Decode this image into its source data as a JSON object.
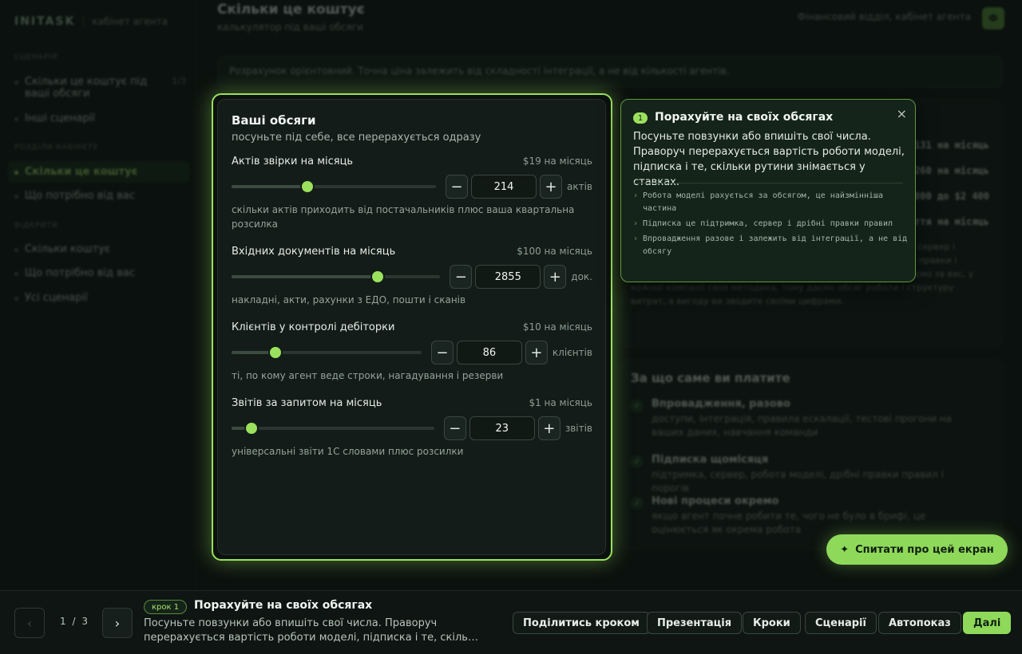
{
  "sidebar": {
    "brand": "INITASK",
    "brand_sub": "кабінет агента",
    "section_scenario": "СЦЕНАРІЙ",
    "scenario_items": [
      {
        "label": "Скільки це коштує під ваші обсяги",
        "count": "1/3"
      },
      {
        "label": "Інші сценарії"
      }
    ],
    "section_page": "РОЗДІЛИ КАБІНЕТУ",
    "page_items": [
      {
        "label": "Скільки це коштує"
      },
      {
        "label": "Що потрібно від вас"
      }
    ],
    "section_jump": "ВІДКРИТИ",
    "jump_items": [
      {
        "label": "Скільки коштує"
      },
      {
        "label": "Що потрібно від вас"
      },
      {
        "label": "Усі сценарії"
      }
    ]
  },
  "header": {
    "title": "Скільки це коштує",
    "subtitle": "калькулятор під ваші обсяги",
    "account": "Фінансовий відділ, кабінет агента",
    "avatar": "Ф"
  },
  "notice": "Розрахунок орієнтовний. Точна ціна залежить від складності інтеграції, а не від кількості агентів.",
  "calculator": {
    "title": "Ваші обсяги",
    "subtitle": "посуньте під себе, все перерахується одразу",
    "fields": [
      {
        "label": "Актів звірки на місяць",
        "price": "$19 на місяць",
        "value": "214",
        "unit": "актів",
        "help": "скільки актів приходить від постачальників плюс ваша квартальна розсилка",
        "fraction": 0.37
      },
      {
        "label": "Вхідних документів на місяць",
        "price": "$100 на місяць",
        "value": "2855",
        "unit": "док.",
        "help": "накладні, акти, рахунки з ЕДО, пошти і сканів",
        "fraction": 0.7
      },
      {
        "label": "Клієнтів у контролі дебіторки",
        "price": "$10 на місяць",
        "value": "86",
        "unit": "клієнтів",
        "help": "ті, по кому агент веде строки, нагадування і резерви",
        "fraction": 0.23
      },
      {
        "label": "Звітів за запитом на місяць",
        "price": "$1 на місяць",
        "value": "23",
        "unit": "звітів",
        "help": "універсальні звіти 1С словами плюс розсилки",
        "fraction": 0.1
      }
    ],
    "minus": "−",
    "plus": "+"
  },
  "costs": {
    "rows": [
      {
        "value": "$131 на місяць"
      },
      {
        "value": "$260 на місяць"
      },
      {
        "value": "$800 до $2 400"
      },
      {
        "value": "$ття на місяць"
      }
    ],
    "paragraph": "Робота моделі рахується за обсягом. Підписка це підтримка, сервер і дрібні правки правил і порогів. Впровадження разове. Дрібні правки і порогів тримаються в межах підписки. Окупність ми не рахуємо за вас, у кожної компанії своя методика, тому даємо обсяг роботи і структуру витрат, а вигоду ви зводите своїми цифрами."
  },
  "pay": {
    "title": "За що саме ви платите",
    "items": [
      {
        "title": "Впровадження, разово",
        "desc": "доступи, інтеграція, правила ескалації, тестові прогони на ваших даних, навчання команди"
      },
      {
        "title": "Підписка щомісяця",
        "desc": "підтримка, сервер, робота моделі, дрібні правки правил і порогів"
      },
      {
        "title": "Нові процеси окремо",
        "desc": "якщо агент почне робити те, чого не було в брифі, це оцінюється як окрема робота"
      }
    ]
  },
  "tooltip": {
    "number": "1",
    "title": "Порахуйте на своїх обсягах",
    "close": "×",
    "body": "Посуньте повзунки або впишіть свої числа. Праворуч перерахується вартість роботи моделі, підписка і те, скільки рутини знімається у ставках.",
    "points": [
      "Робота моделі рахується за обсягом, це найзмінніша частина",
      "Підписка це підтримка, сервер і дрібні правки правил",
      "Впровадження разове і залежить від інтеграції, а не від обсягу"
    ]
  },
  "ask_button": {
    "icon": "✦",
    "label": "Спитати про цей екран"
  },
  "tour": {
    "prev": "‹",
    "next": "›",
    "page": "1",
    "sep": "/",
    "total": "3",
    "badge": "крок 1",
    "title": "Порахуйте на своїх обсягах",
    "desc": "Посуньте повзунки або впишіть свої числа. Праворуч перерахується вартість роботи моделі, підписка і те, скільки рутини знімається у ставках.",
    "buttons": [
      "Поділитись кроком",
      "Презентація",
      "Кроки",
      "Сценарії",
      "Автопоказ"
    ],
    "next_label": "Далі"
  }
}
